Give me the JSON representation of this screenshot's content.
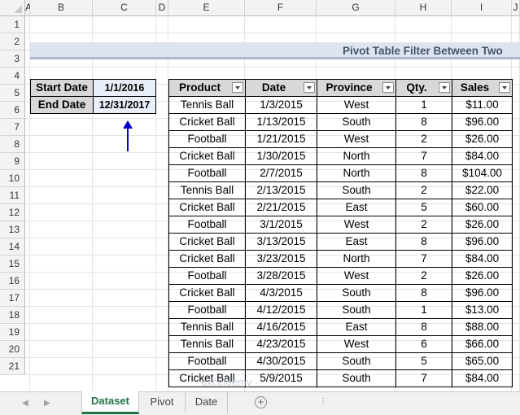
{
  "columns": [
    "A",
    "B",
    "C",
    "D",
    "E",
    "F",
    "G",
    "H",
    "I",
    "J"
  ],
  "rows": [
    "1",
    "2",
    "3",
    "4",
    "5",
    "6",
    "7",
    "8",
    "9",
    "10",
    "11",
    "12",
    "13",
    "14",
    "15",
    "16",
    "17",
    "18",
    "19",
    "20",
    "21"
  ],
  "title": "Pivot Table Filter Between Two",
  "criteria": {
    "start_label": "Start Date",
    "start_value": "1/1/2016",
    "end_label": "End Date",
    "end_value": "12/31/2017"
  },
  "table": {
    "headers": [
      "Product",
      "Date",
      "Province",
      "Qty.",
      "Sales"
    ],
    "rows": [
      [
        "Tennis Ball",
        "1/3/2015",
        "West",
        "1",
        "$11.00"
      ],
      [
        "Cricket Ball",
        "1/13/2015",
        "South",
        "8",
        "$96.00"
      ],
      [
        "Football",
        "1/21/2015",
        "West",
        "2",
        "$26.00"
      ],
      [
        "Cricket Ball",
        "1/30/2015",
        "North",
        "7",
        "$84.00"
      ],
      [
        "Football",
        "2/7/2015",
        "North",
        "8",
        "$104.00"
      ],
      [
        "Tennis Ball",
        "2/13/2015",
        "South",
        "2",
        "$22.00"
      ],
      [
        "Cricket Ball",
        "2/21/2015",
        "East",
        "5",
        "$60.00"
      ],
      [
        "Football",
        "3/1/2015",
        "West",
        "2",
        "$26.00"
      ],
      [
        "Cricket Ball",
        "3/13/2015",
        "East",
        "8",
        "$96.00"
      ],
      [
        "Cricket Ball",
        "3/23/2015",
        "North",
        "7",
        "$84.00"
      ],
      [
        "Football",
        "3/28/2015",
        "West",
        "2",
        "$26.00"
      ],
      [
        "Cricket Ball",
        "4/3/2015",
        "South",
        "8",
        "$96.00"
      ],
      [
        "Football",
        "4/12/2015",
        "South",
        "1",
        "$13.00"
      ],
      [
        "Tennis Ball",
        "4/16/2015",
        "East",
        "8",
        "$88.00"
      ],
      [
        "Tennis Ball",
        "4/23/2015",
        "West",
        "6",
        "$66.00"
      ],
      [
        "Football",
        "4/30/2015",
        "South",
        "5",
        "$65.00"
      ],
      [
        "Cricket Ball",
        "5/9/2015",
        "South",
        "7",
        "$84.00"
      ]
    ]
  },
  "watermark": "exceldemy",
  "arrow_color": "#0000cc",
  "tabs": [
    {
      "label": "Dataset",
      "active": true
    },
    {
      "label": "Pivot",
      "active": false
    },
    {
      "label": "Date",
      "active": false
    }
  ],
  "add_sheet_symbol": "+",
  "nav_prev": "◀",
  "nav_next": "▶",
  "tab_overflow": "⋮"
}
